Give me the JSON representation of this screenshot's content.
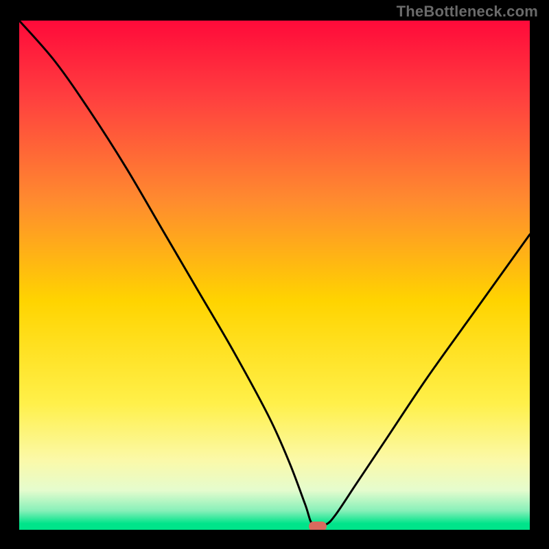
{
  "watermark": "TheBottleneck.com",
  "colors": {
    "frame_bg": "#000000",
    "curve": "#000000",
    "marker": "#d96a5e",
    "gradient_stops": [
      {
        "pos": 0.0,
        "color": "#ff0a3a"
      },
      {
        "pos": 0.15,
        "color": "#ff3f3f"
      },
      {
        "pos": 0.35,
        "color": "#ff8a2f"
      },
      {
        "pos": 0.55,
        "color": "#ffd400"
      },
      {
        "pos": 0.75,
        "color": "#fff04a"
      },
      {
        "pos": 0.86,
        "color": "#fbf9a8"
      },
      {
        "pos": 0.92,
        "color": "#e5fcce"
      },
      {
        "pos": 0.96,
        "color": "#87f0b9"
      },
      {
        "pos": 0.985,
        "color": "#00e48a"
      },
      {
        "pos": 1.0,
        "color": "#00e48a"
      }
    ]
  },
  "chart_data": {
    "type": "line",
    "title": "",
    "xlabel": "",
    "ylabel": "",
    "xlim": [
      0,
      100
    ],
    "ylim": [
      0,
      100
    ],
    "series": [
      {
        "name": "bottleneck-curve",
        "x": [
          0,
          7,
          14,
          21,
          28,
          35,
          42,
          49,
          53,
          56,
          57.5,
          60,
          62,
          66,
          72,
          80,
          90,
          100
        ],
        "values": [
          100,
          92,
          82,
          71,
          59,
          47,
          35,
          22,
          13,
          5,
          1,
          1,
          3,
          9,
          18,
          30,
          44,
          58
        ]
      }
    ],
    "annotations": [
      {
        "name": "optimal-marker",
        "x": 58.5,
        "y": 0.7
      }
    ],
    "grid": false,
    "legend": false
  }
}
